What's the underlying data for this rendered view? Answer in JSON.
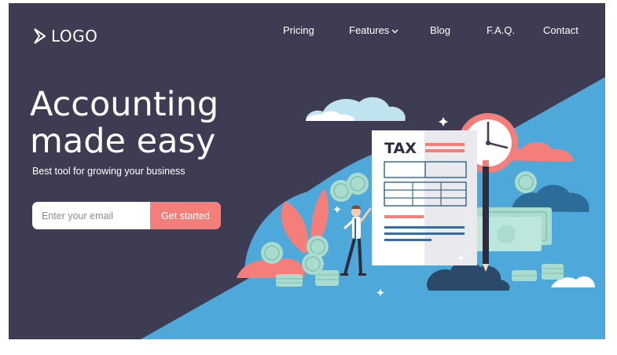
{
  "brand": {
    "logo_text": "LOGO"
  },
  "nav": {
    "items": [
      {
        "label": "Pricing"
      },
      {
        "label": "Features"
      },
      {
        "label": "Blog"
      },
      {
        "label": "F.A.Q."
      },
      {
        "label": "Contact"
      }
    ]
  },
  "hero": {
    "title_line1": "Accounting",
    "title_line2": "made easy",
    "subtitle": "Best tool for growing your business",
    "email_placeholder": "Enter your email",
    "cta_label": "Get started"
  },
  "illustration": {
    "document_heading": "TAX"
  },
  "colors": {
    "background": "#3e3c52",
    "accent_blue": "#4ea8da",
    "accent_coral": "#f47f7a",
    "money_green": "#a9dccf",
    "white": "#ffffff"
  },
  "icons": [
    "chevron-right-icon",
    "chevron-down-icon",
    "clock-icon",
    "coin-icon",
    "banknote-icon",
    "pencil-icon",
    "cloud-icon",
    "leaf-icon",
    "sparkle-icon"
  ]
}
